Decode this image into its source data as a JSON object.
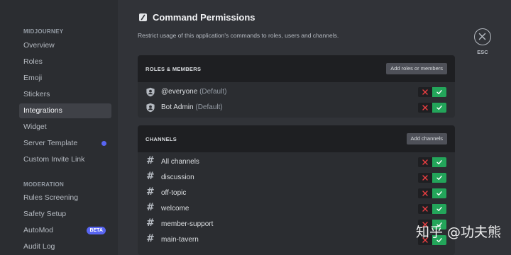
{
  "sidebar": {
    "sections": [
      {
        "header": "MIDJOURNEY",
        "items": [
          {
            "label": "Overview"
          },
          {
            "label": "Roles"
          },
          {
            "label": "Emoji"
          },
          {
            "label": "Stickers"
          },
          {
            "label": "Integrations",
            "active": true
          },
          {
            "label": "Widget"
          },
          {
            "label": "Server Template",
            "dot": true
          },
          {
            "label": "Custom Invite Link"
          }
        ]
      },
      {
        "header": "MODERATION",
        "items": [
          {
            "label": "Rules Screening"
          },
          {
            "label": "Safety Setup"
          },
          {
            "label": "AutoMod",
            "badge": "BETA"
          },
          {
            "label": "Audit Log"
          }
        ]
      }
    ]
  },
  "main": {
    "title": "Command Permissions",
    "subtitle": "Restrict usage of this application's commands to roles, users and channels.",
    "esc_label": "ESC",
    "roles_panel": {
      "title": "ROLES & MEMBERS",
      "button": "Add roles or members",
      "rows": [
        {
          "name": "@everyone",
          "note": "(Default)",
          "icon": "role-shield-icon",
          "state": "allow"
        },
        {
          "name": "Bot Admin",
          "note": "(Default)",
          "icon": "role-shield-icon",
          "state": "allow"
        }
      ]
    },
    "channels_panel": {
      "title": "CHANNELS",
      "button": "Add channels",
      "rows": [
        {
          "name": "All channels",
          "icon": "hashtag-icon",
          "state": "allow"
        },
        {
          "name": "discussion",
          "icon": "hashtag-icon",
          "state": "allow"
        },
        {
          "name": "off-topic",
          "icon": "hashtag-icon",
          "state": "allow"
        },
        {
          "name": "welcome",
          "icon": "hashtag-icon",
          "state": "allow"
        },
        {
          "name": "member-support",
          "icon": "hashtag-icon",
          "state": "allow"
        },
        {
          "name": "main-tavern",
          "icon": "hashtag-icon",
          "state": "allow"
        }
      ]
    }
  },
  "watermark": "知乎 @功夫熊",
  "colors": {
    "accent": "#5865f2",
    "allow_green": "#23a55a",
    "deny_red": "#f23f43",
    "background": "#313338",
    "sidebar": "#2b2d31"
  }
}
